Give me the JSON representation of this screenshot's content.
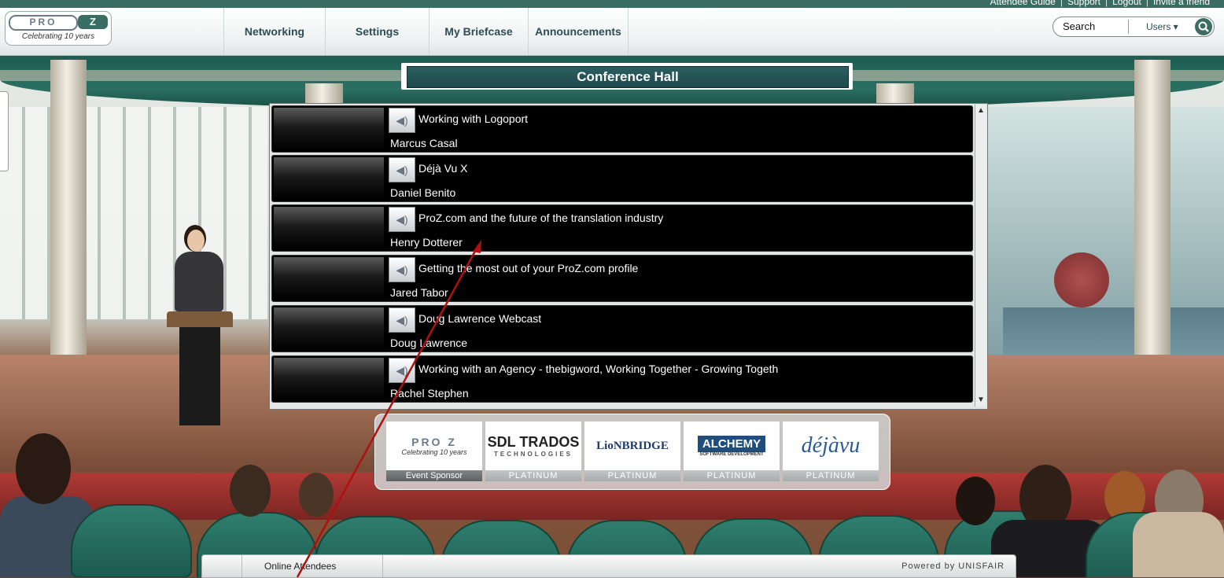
{
  "top_links": [
    "Attendee Guide",
    "Support",
    "Logout",
    "Invite a friend"
  ],
  "logo": {
    "pro": "PRO",
    "z": "Z",
    "tagline": "Celebrating 10 years"
  },
  "nav": {
    "tabs": [
      "Networking",
      "Settings",
      "My Briefcase",
      "Announcements"
    ]
  },
  "search": {
    "label": "Search",
    "users": "Users ▾",
    "icon": "search-icon"
  },
  "hall": {
    "title": "Conference Hall"
  },
  "sessions": [
    {
      "title": "Working with Logoport",
      "speaker": "Marcus Casal"
    },
    {
      "title": "Déjà Vu X",
      "speaker": "Daniel Benito"
    },
    {
      "title": "ProZ.com and the future of the translation industry",
      "speaker": "Henry Dotterer"
    },
    {
      "title": "Getting the most out of  your ProZ.com profile",
      "speaker": "Jared Tabor"
    },
    {
      "title": "Doug Lawrence Webcast",
      "speaker": " Doug Lawrence"
    },
    {
      "title": "Working with an Agency - thebigword, Working Together - Growing Togeth",
      "speaker": "Rachel Stephen"
    }
  ],
  "sponsors": [
    {
      "logo": "PRO Z",
      "tagline": "Celebrating 10 years",
      "caption": "Event Sponsor"
    },
    {
      "logo": "SDL TRADOS",
      "sub": "TECHNOLOGIES",
      "caption": "PLATINUM"
    },
    {
      "logo": "LioNBRIDGE",
      "caption": "PLATINUM"
    },
    {
      "logo": "ALCHEMY",
      "sub": "SOFTWARE DEVELOPMENT",
      "caption": "PLATINUM"
    },
    {
      "logo": "déjàvu",
      "caption": "PLATINUM"
    }
  ],
  "bottom": {
    "online": "Online Attendees",
    "powered": "Powered by UNISFAIR"
  },
  "colors": {
    "brand": "#3b6e62",
    "title_bar": "#1e4a4d",
    "annotation_arrow": "#b01010"
  }
}
